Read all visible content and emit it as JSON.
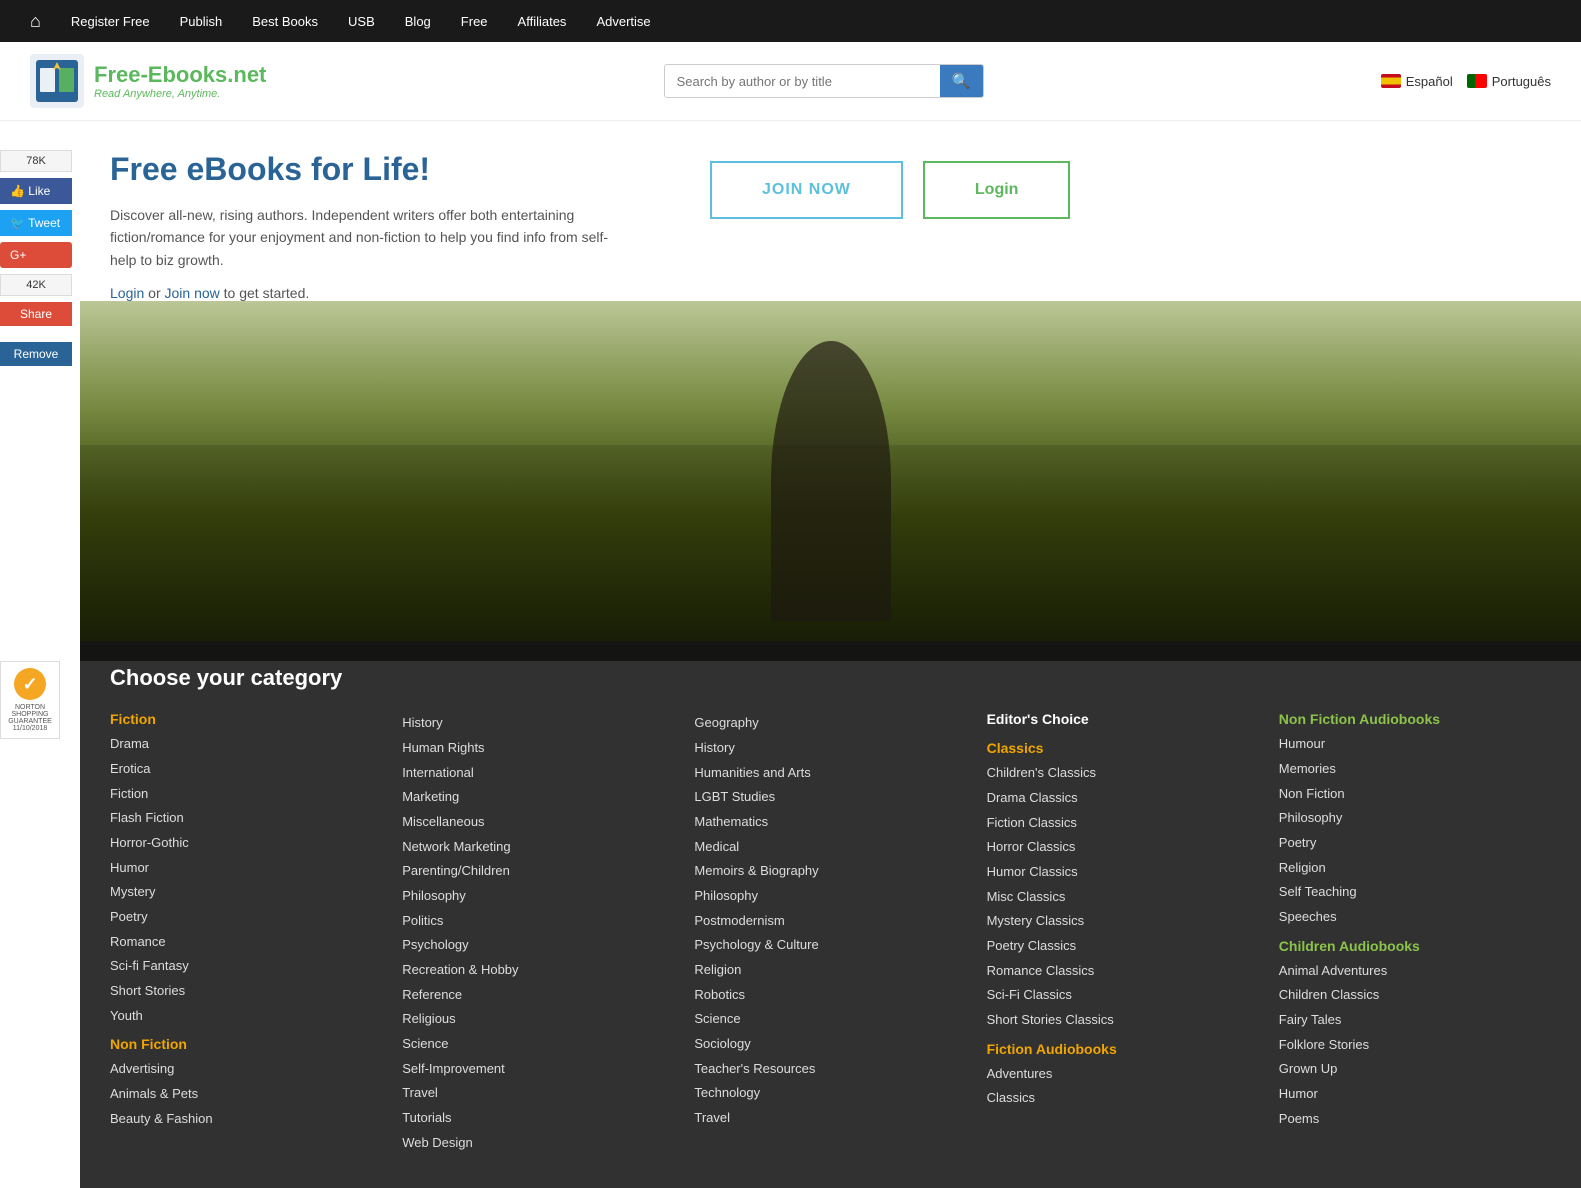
{
  "topnav": {
    "home_icon": "⌂",
    "links": [
      {
        "label": "Register Free",
        "name": "register-free"
      },
      {
        "label": "Publish",
        "name": "publish"
      },
      {
        "label": "Best Books",
        "name": "best-books"
      },
      {
        "label": "USB",
        "name": "usb"
      },
      {
        "label": "Blog",
        "name": "blog"
      },
      {
        "label": "Free",
        "name": "free"
      },
      {
        "label": "Affiliates",
        "name": "affiliates"
      },
      {
        "label": "Advertise",
        "name": "advertise"
      }
    ]
  },
  "header": {
    "logo_name": "Free-Ebooks",
    "logo_tld": ".net",
    "tagline": "Read Anywhere, Anytime.",
    "search_placeholder": "Search by author or by title",
    "lang1": "Español",
    "lang2": "Português"
  },
  "sidebar": {
    "like_count": "78K",
    "like_label": "Like",
    "tweet_label": "Tweet",
    "gplus_label": "G+",
    "share_count": "42K",
    "share_label": "Share",
    "remove_label": "Remove"
  },
  "hero": {
    "title": "Free eBooks for Life!",
    "description": "Discover all-new, rising authors. Independent writers offer both entertaining fiction/romance for your enjoyment and non-fiction to help you find info from self-help to biz growth.",
    "cta_text": "Login or Join now to get started.",
    "login_label": "Login",
    "join_label": "Join now",
    "btn_join": "JOIN NOW",
    "btn_login": "Login"
  },
  "categories": {
    "title": "Choose your category",
    "columns": [
      {
        "sections": [
          {
            "header": "Fiction",
            "header_color": "orange",
            "items": [
              "Drama",
              "Erotica",
              "Fiction",
              "Flash Fiction",
              "Horror-Gothic",
              "Humor",
              "Mystery",
              "Poetry",
              "Romance",
              "Sci-fi Fantasy",
              "Short Stories",
              "Youth"
            ]
          },
          {
            "header": "Non Fiction",
            "header_color": "orange",
            "items": [
              "Advertising",
              "Animals & Pets",
              "Beauty & Fashion"
            ]
          }
        ]
      },
      {
        "sections": [
          {
            "header": "",
            "header_color": "",
            "items": [
              "History",
              "Human Rights",
              "International",
              "Marketing",
              "Miscellaneous",
              "Network Marketing",
              "Parenting/Children",
              "Philosophy",
              "Politics",
              "Psychology",
              "Recreation & Hobby",
              "Reference",
              "Religious",
              "Science",
              "Self-Improvement",
              "Travel",
              "Tutorials",
              "Web Design"
            ]
          }
        ]
      },
      {
        "sections": [
          {
            "header": "",
            "header_color": "",
            "items": [
              "Geography",
              "History",
              "Humanities and Arts",
              "LGBT Studies",
              "Mathematics",
              "Medical",
              "Memoirs & Biography",
              "Philosophy",
              "Postmodernism",
              "Psychology & Culture",
              "Religion",
              "Robotics",
              "Science",
              "Sociology",
              "Teacher's Resources",
              "Technology",
              "Travel"
            ]
          }
        ]
      },
      {
        "sections": [
          {
            "header": "Editor's Choice",
            "header_color": "white",
            "items": []
          },
          {
            "header": "Classics",
            "header_color": "orange",
            "items": [
              "Children's Classics",
              "Drama Classics",
              "Fiction Classics",
              "Horror Classics",
              "Humor Classics",
              "Misc Classics",
              "Mystery Classics",
              "Poetry Classics",
              "Romance Classics",
              "Sci-Fi Classics",
              "Short Stories Classics"
            ]
          },
          {
            "header": "Fiction Audiobooks",
            "header_color": "orange",
            "items": [
              "Adventures",
              "Classics"
            ]
          }
        ]
      },
      {
        "sections": [
          {
            "header": "Non Fiction Audiobooks",
            "header_color": "green",
            "items": [
              "Humour",
              "Memories",
              "Non Fiction",
              "Philosophy",
              "Poetry",
              "Religion",
              "Self Teaching",
              "Speeches"
            ]
          },
          {
            "header": "Children Audiobooks",
            "header_color": "green",
            "items": [
              "Animal Adventures",
              "Children Classics",
              "Fairy Tales",
              "Folklore Stories",
              "Grown Up",
              "Humor",
              "Poems"
            ]
          }
        ]
      }
    ]
  }
}
